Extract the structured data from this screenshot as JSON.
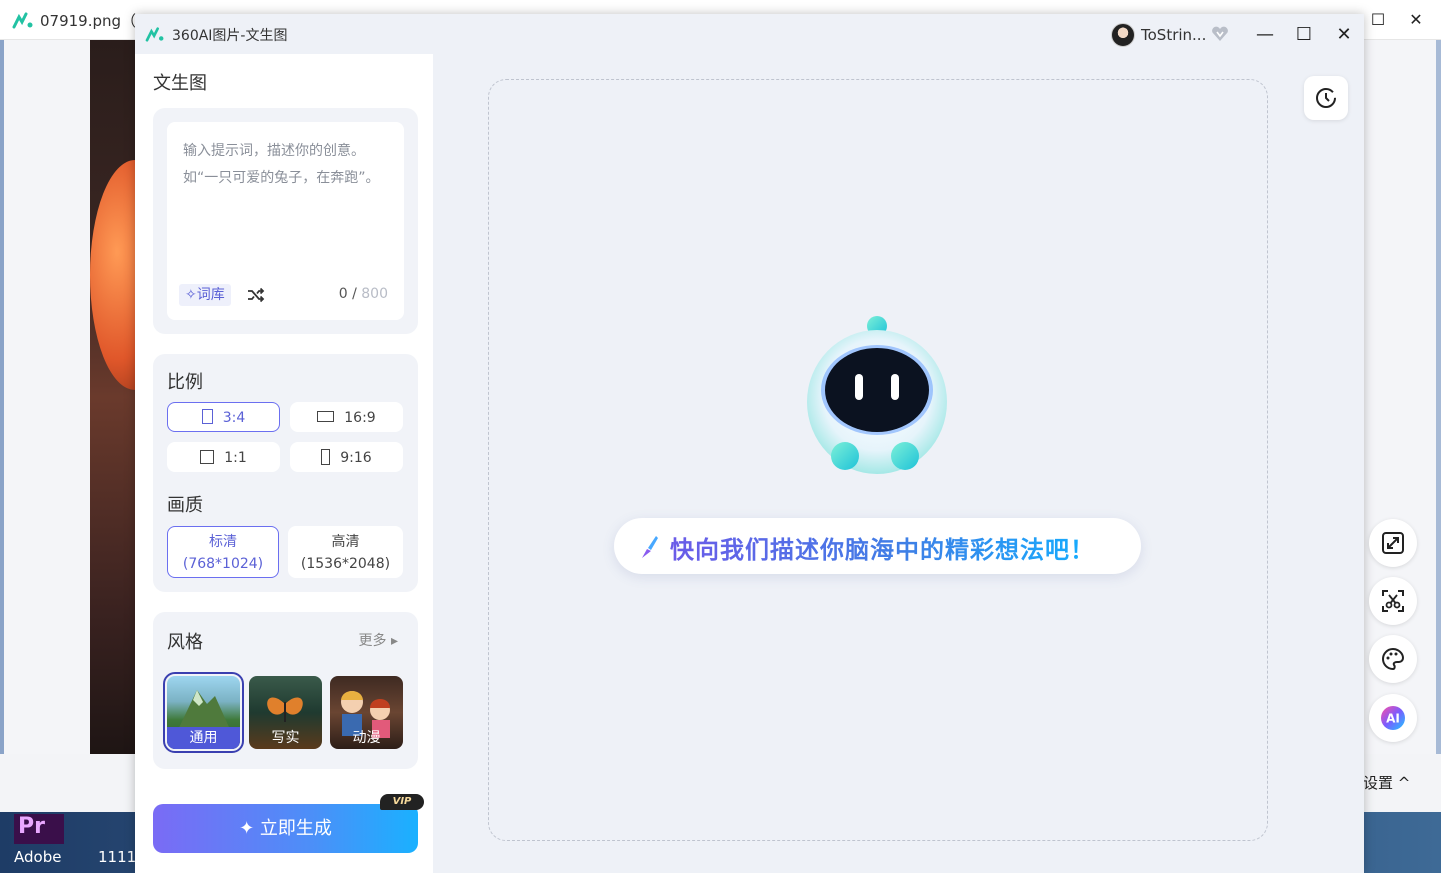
{
  "background": {
    "window_title": "07919.png（",
    "settings_text": "设置",
    "desktop_icon_label": "Adobe",
    "desktop_icon2_label": "1111"
  },
  "app": {
    "title": "360AI图片-文生图",
    "user_name": "ToStrin..."
  },
  "left": {
    "section_title": "文生图",
    "prompt": {
      "placeholder": "输入提示词，描述你的创意。如“一只可爱的兔子，在奔跑”。",
      "lexicon_label": "词库",
      "count": "0",
      "max": "800"
    },
    "ratio": {
      "title": "比例",
      "options": [
        "3:4",
        "16:9",
        "1:1",
        "9:16"
      ],
      "selected": "3:4"
    },
    "quality": {
      "title": "画质",
      "options": [
        {
          "name": "标清",
          "size": "(768*1024)"
        },
        {
          "name": "高清",
          "size": "(1536*2048)"
        }
      ],
      "selected": "标清"
    },
    "style": {
      "title": "风格",
      "more": "更多",
      "items": [
        "通用",
        "写实",
        "动漫"
      ],
      "selected": "通用"
    },
    "generate_label": "立即生成",
    "vip_label": "VIP"
  },
  "canvas": {
    "hint": "快向我们描述你脑海中的精彩想法吧！"
  },
  "colors": {
    "accent": "#6b6ff0",
    "gradient_start": "#7a6bf5",
    "gradient_end": "#1ab1ff"
  }
}
